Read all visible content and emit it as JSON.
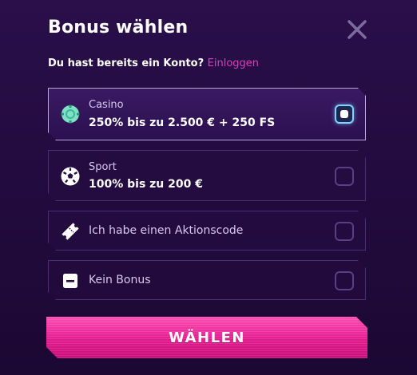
{
  "header": {
    "title": "Bonus wählen",
    "close_icon": "close-icon"
  },
  "login": {
    "prompt": "Du hast bereits ein Konto?",
    "link": "Einloggen"
  },
  "options": [
    {
      "label": "Casino",
      "value": "250% bis zu 2.500 € + 250 FS",
      "icon": "casino-chip-icon",
      "selected": true
    },
    {
      "label": "Sport",
      "value": "100% bis zu 200 €",
      "icon": "soccer-ball-icon",
      "selected": false
    },
    {
      "label": "Ich habe einen Aktionscode",
      "icon": "ticket-icon",
      "selected": false
    },
    {
      "label": "Kein Bonus",
      "icon": "no-bonus-icon",
      "selected": false
    }
  ],
  "cta": {
    "label": "WÄHLEN"
  },
  "colors": {
    "accent": "#e21c8e",
    "link": "#e23ab8",
    "selected_check": "#7fd3ff",
    "background": "#230b3f"
  }
}
